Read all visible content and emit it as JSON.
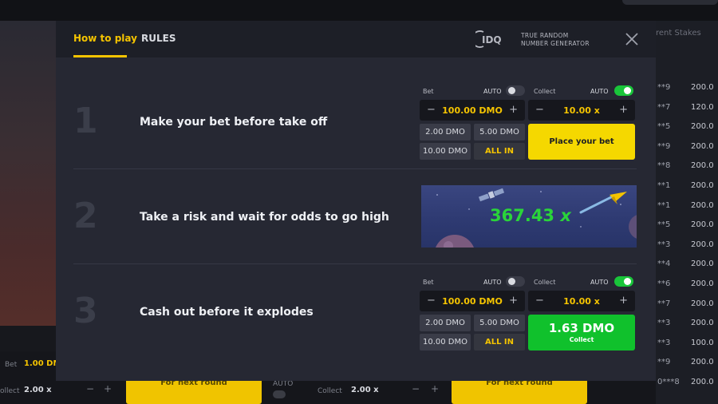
{
  "modal": {
    "tabs": [
      {
        "label": "How to play",
        "active": true
      },
      {
        "label": "RULES",
        "active": false
      }
    ],
    "provider": {
      "line1": "TRUE RANDOM",
      "line2": "NUMBER GENERATOR",
      "logo": "IDQ"
    },
    "close_icon": "close-icon",
    "accent": "#f5c400"
  },
  "steps": [
    {
      "number": "1",
      "text": "Make your bet before take off"
    },
    {
      "number": "2",
      "text": "Take a risk and wait for odds to go high"
    },
    {
      "number": "3",
      "text": "Cash out before it explodes"
    }
  ],
  "panel1": {
    "bet_label": "Bet",
    "bet_auto_label": "AUTO",
    "bet_auto_on": false,
    "collect_label": "Collect",
    "collect_auto_label": "AUTO",
    "collect_auto_on": true,
    "bet_value": "100.00 DMO",
    "collect_value": "10.00 x",
    "minus": "−",
    "plus": "+",
    "quick": [
      "2.00 DMO",
      "5.00 DMO",
      "10.00 DMO",
      "ALL IN"
    ],
    "action": "Place your bet"
  },
  "panel3": {
    "bet_label": "Bet",
    "bet_auto_label": "AUTO",
    "bet_auto_on": false,
    "collect_label": "Collect",
    "collect_auto_label": "AUTO",
    "collect_auto_on": true,
    "bet_value": "100.00 DMO",
    "collect_value": "10.00 x",
    "minus": "−",
    "plus": "+",
    "quick": [
      "2.00 DMO",
      "5.00 DMO",
      "10.00 DMO",
      "ALL IN"
    ],
    "collect_amount": "1.63 DMO",
    "collect_caption": "Collect"
  },
  "scene": {
    "multiplier": "367.43",
    "suffix": "x"
  },
  "background": {
    "right_header": "rent Stakes",
    "rows": [
      {
        "user": "**9",
        "value": "200.0"
      },
      {
        "user": "**7",
        "value": "120.0"
      },
      {
        "user": "**5",
        "value": "200.0"
      },
      {
        "user": "**9",
        "value": "200.0"
      },
      {
        "user": "**8",
        "value": "200.0"
      },
      {
        "user": "**1",
        "value": "200.0"
      },
      {
        "user": "**1",
        "value": "200.0"
      },
      {
        "user": "**5",
        "value": "200.0"
      },
      {
        "user": "**3",
        "value": "200.0"
      },
      {
        "user": "**4",
        "value": "200.0"
      },
      {
        "user": "**6",
        "value": "200.0"
      },
      {
        "user": "**7",
        "value": "200.0"
      },
      {
        "user": "**3",
        "value": "200.0"
      },
      {
        "user": "**3",
        "value": "100.0"
      },
      {
        "user": "**9",
        "value": "200.0"
      },
      {
        "user": "0***8",
        "value": "200.0"
      }
    ],
    "bottom": {
      "bet_label": "Bet",
      "bet_value": "1.00 DM",
      "collect_label_left": "ollect",
      "collect_value_left": "2.00 x",
      "auto_label": "AUTO",
      "collect_label_right": "Collect",
      "collect_value_right": "2.00 x",
      "next_round_left": "For next round",
      "next_round_right": "For next round"
    }
  }
}
